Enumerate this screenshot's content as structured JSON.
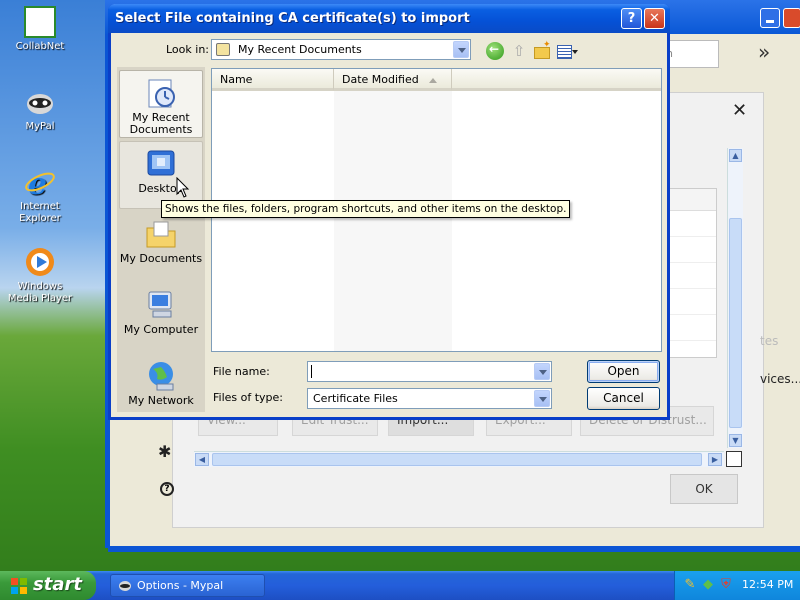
{
  "desktop": {
    "icons": [
      {
        "label": "CollabNet"
      },
      {
        "label": "MyPal"
      },
      {
        "label": "Internet Explorer"
      },
      {
        "label": "Windows Media Player"
      }
    ]
  },
  "background_window": {
    "search_text": "ch",
    "chevron": "»",
    "close_glyph": "✕",
    "buttons": [
      "View...",
      "Edit Trust...",
      "Import...",
      "Export...",
      "Delete or Distrust..."
    ],
    "side_text_1": "tes",
    "side_text_2": "vices...",
    "ok_label": "OK"
  },
  "dialog": {
    "title": "Select File containing CA certificate(s) to import",
    "help_glyph": "?",
    "close_glyph": "✕",
    "look_in_label": "Look in:",
    "look_in_value": "My Recent Documents",
    "places": [
      {
        "label": "My Recent Documents"
      },
      {
        "label": "Desktop"
      },
      {
        "label": "My Documents"
      },
      {
        "label": "My Computer"
      },
      {
        "label": "My Network"
      }
    ],
    "columns": [
      "Name",
      "Date Modified"
    ],
    "file_name_label": "File name:",
    "file_name_value": "",
    "file_type_label": "Files of type:",
    "file_type_value": "Certificate Files",
    "open_label": "Open",
    "cancel_label": "Cancel",
    "tooltip": "Shows the files, folders, program shortcuts, and other items on the desktop."
  },
  "taskbar": {
    "start_label": "start",
    "task_label": "Options - Mypal",
    "clock": "12:54 PM"
  }
}
